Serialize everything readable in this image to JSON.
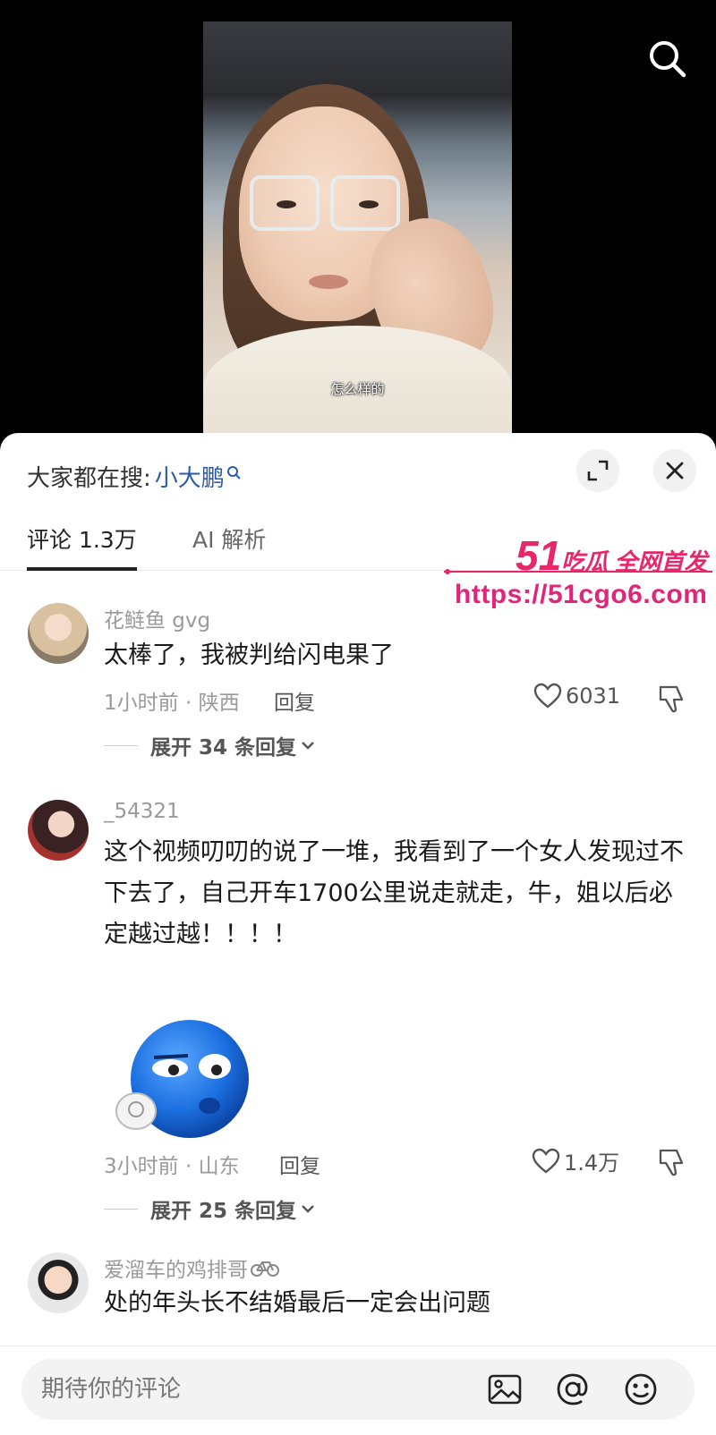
{
  "video": {
    "caption": "怎么样的"
  },
  "header": {
    "trending_label": "大家都在搜:",
    "trending_keyword": "小大鹏"
  },
  "tabs": [
    {
      "label": "评论 1.3万"
    },
    {
      "label": "AI 解析"
    }
  ],
  "watermark": {
    "logo_num": "51",
    "logo_text": "吃瓜 全网首发",
    "url": "https://51cgo6.com",
    "color": "#e8266a"
  },
  "comments": [
    {
      "user": "花鲢鱼 gvg",
      "text": "太棒了，我被判给闪电果了",
      "meta": "1小时前 · 陕西",
      "reply": "回复",
      "likes": "6031",
      "expand": "展开 34 条回复"
    },
    {
      "user": "_54321",
      "text": "这个视频叨叨的说了一堆，我看到了一个女人发现过不下去了，自己开车1700公里说走就走，牛，姐以后必定越过越！！！！",
      "meta": "3小时前 · 山东",
      "reply": "回复",
      "likes": "1.4万",
      "expand": "展开 25 条回复"
    },
    {
      "user": "爱溜车的鸡排哥",
      "text": "处的年头长不结婚最后一定会出问题"
    }
  ],
  "input": {
    "placeholder": "期待你的评论"
  },
  "icons": [
    "search-icon",
    "expand-icon",
    "close-icon",
    "heart-icon",
    "dislike-icon",
    "chevron-down-icon",
    "image-icon",
    "at-icon",
    "emoji-icon",
    "bicycle-icon"
  ]
}
